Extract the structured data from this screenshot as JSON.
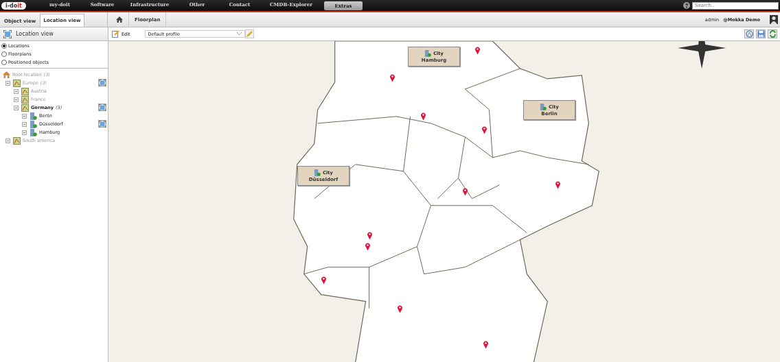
{
  "logo": {
    "main": "i-do",
    "accent": "it"
  },
  "nav": [
    {
      "label": "my-doit",
      "selected": false
    },
    {
      "label": "Software",
      "selected": false
    },
    {
      "label": "Infrastructure",
      "selected": false
    },
    {
      "label": "Other",
      "selected": false
    },
    {
      "label": "Contact",
      "selected": false
    },
    {
      "label": "CMDB-Explorer",
      "selected": false
    },
    {
      "label": "Extras",
      "selected": true
    }
  ],
  "search": {
    "placeholder": "Search.."
  },
  "tabs": [
    {
      "label": "Object view",
      "selected": false
    },
    {
      "label": "Location view",
      "selected": true
    }
  ],
  "breadcrumb": [
    "Floorplan"
  ],
  "user": {
    "name": "admin",
    "tenant": "@Mokka Demo"
  },
  "sidebar": {
    "title": "Location view",
    "options": [
      {
        "label": "Locations",
        "selected": true
      },
      {
        "label": "Floorplans",
        "selected": false
      },
      {
        "label": "Positioned objects",
        "selected": false
      }
    ],
    "tree": [
      {
        "kind": "root",
        "label": "Root location",
        "count": "(3)",
        "dimmed": true,
        "selected": false,
        "action": false,
        "children": [
          {
            "kind": "country",
            "label": "Europe",
            "count": "(3)",
            "dimmed": true,
            "selected": false,
            "action": true,
            "children": [
              {
                "kind": "country",
                "label": "Austria",
                "dimmed": true,
                "selected": false,
                "action": false
              },
              {
                "kind": "country",
                "label": "France",
                "dimmed": true,
                "selected": false,
                "action": false
              },
              {
                "kind": "country",
                "label": "Germany",
                "count": "(3)",
                "dimmed": false,
                "selected": true,
                "action": true,
                "children": [
                  {
                    "kind": "city",
                    "label": "Berlin",
                    "dimmed": false,
                    "selected": false,
                    "action": false
                  },
                  {
                    "kind": "city",
                    "label": "Düsseldorf",
                    "dimmed": false,
                    "selected": false,
                    "action": true
                  },
                  {
                    "kind": "city",
                    "label": "Hamburg",
                    "dimmed": false,
                    "selected": false,
                    "action": false
                  }
                ]
              }
            ]
          },
          {
            "kind": "country",
            "label": "South america",
            "dimmed": true,
            "selected": false,
            "action": false
          }
        ]
      }
    ]
  },
  "toolbar": {
    "edit": "Edit",
    "profile": "Default profile"
  },
  "map": {
    "kind": "picture",
    "objects": [
      {
        "type": "City",
        "name": "Hamburg"
      },
      {
        "type": "City",
        "name": "Berlin"
      },
      {
        "type": "City",
        "name": "Düsseldorf"
      }
    ]
  }
}
